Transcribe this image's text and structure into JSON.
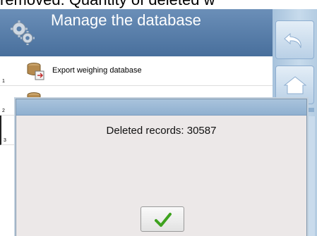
{
  "caption": "removed. Quantity of deleted w",
  "header": {
    "title": "Manage the database",
    "icon": "gears-icon"
  },
  "side": {
    "back_icon": "undo-arrow-icon",
    "home_icon": "home-icon"
  },
  "list": {
    "items": [
      {
        "number": "1",
        "label": "Export weighing database",
        "icon": "export-database-icon"
      },
      {
        "number": "2",
        "label": "",
        "icon": "database-icon"
      },
      {
        "number": "3",
        "label": "",
        "icon": "database-icon"
      }
    ]
  },
  "dialog": {
    "message": "Deleted records: 30587",
    "ok_icon": "checkmark-icon"
  },
  "colors": {
    "header": "#5a80ab",
    "side_panel": "#b9d0e6",
    "dialog_bg": "#ece8e8",
    "ok_check": "#3ea21f"
  }
}
